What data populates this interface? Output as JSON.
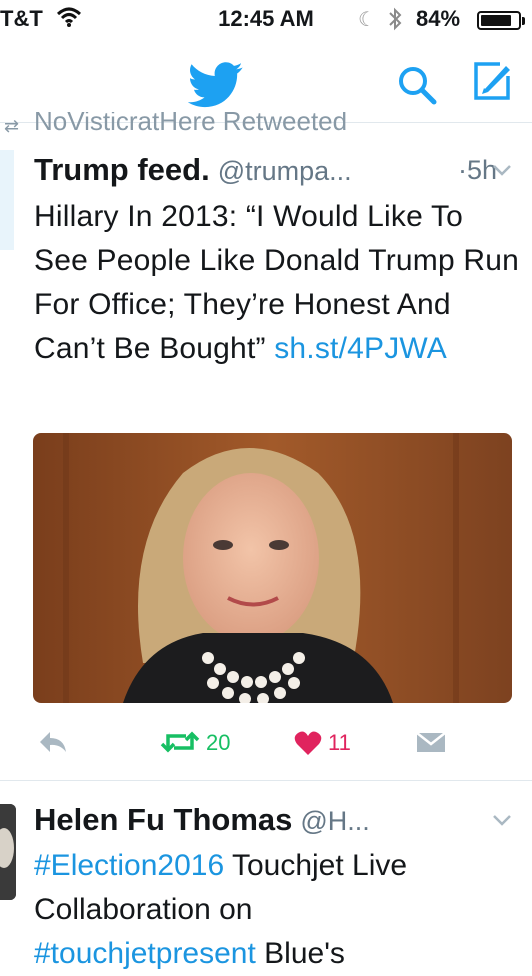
{
  "status_bar": {
    "carrier": "T&T",
    "time": "12:45 AM",
    "battery_percent": "84%",
    "battery_level": 0.84
  },
  "nav": {
    "icons": [
      "twitter-bird-icon",
      "search-icon",
      "compose-icon"
    ],
    "brand_color": "#1da1f2"
  },
  "timeline": {
    "retweet_context": "NoVisticratHere Retweeted",
    "tweet1": {
      "display_name": "Trump feed.",
      "handle": "@trumpa...",
      "time": "·5h",
      "text": "Hillary In 2013: “I Would Like To See People Like Donald Trump Run For Office; They’re Honest And Can’t Be Bought” ",
      "link": "sh.st/4PJWA",
      "retweets": "20",
      "likes": "11"
    },
    "tweet2": {
      "display_name": "Helen Fu Thomas",
      "handle": "@H...",
      "hashtag": "#Election2016",
      "text_after_hashtag": " Touchjet Live Collaboration on",
      "hashtag2": "#touchjetpresent",
      "text_tail": " Blue's"
    }
  },
  "colors": {
    "link": "#1b95e0",
    "retweet": "#17bf63",
    "like": "#e0245e",
    "muted": "#657786"
  }
}
